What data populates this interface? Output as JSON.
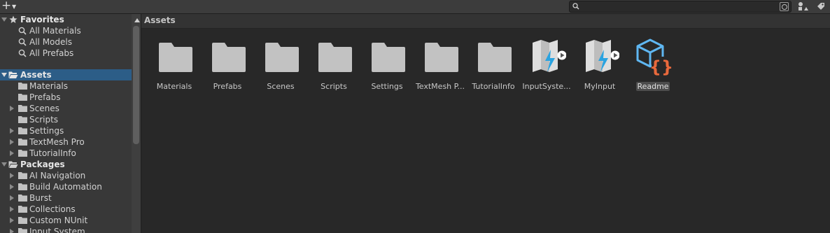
{
  "toolbar": {
    "add_icon": "plus-icon",
    "search": {
      "value": "",
      "placeholder": ""
    }
  },
  "sidebar": {
    "favorites": {
      "label": "Favorites",
      "items": [
        {
          "label": "All Materials"
        },
        {
          "label": "All Models"
        },
        {
          "label": "All Prefabs"
        }
      ]
    },
    "assets": {
      "label": "Assets",
      "items": [
        {
          "label": "Materials"
        },
        {
          "label": "Prefabs"
        },
        {
          "label": "Scenes"
        },
        {
          "label": "Scripts"
        },
        {
          "label": "Settings"
        },
        {
          "label": "TextMesh Pro"
        },
        {
          "label": "TutorialInfo"
        }
      ]
    },
    "packages": {
      "label": "Packages",
      "items": [
        {
          "label": "AI Navigation"
        },
        {
          "label": "Build Automation"
        },
        {
          "label": "Burst"
        },
        {
          "label": "Collections"
        },
        {
          "label": "Custom NUnit"
        },
        {
          "label": "Input System"
        }
      ]
    }
  },
  "main": {
    "breadcrumb": "Assets",
    "assets": [
      {
        "name": "Materials",
        "icon": "folder-icon"
      },
      {
        "name": "Prefabs",
        "icon": "folder-icon"
      },
      {
        "name": "Scenes",
        "icon": "folder-icon"
      },
      {
        "name": "Scripts",
        "icon": "folder-icon"
      },
      {
        "name": "Settings",
        "icon": "folder-icon"
      },
      {
        "name": "TextMesh P...",
        "icon": "folder-icon"
      },
      {
        "name": "TutorialInfo",
        "icon": "folder-icon"
      },
      {
        "name": "InputSyste...",
        "icon": "input-actions-icon"
      },
      {
        "name": "MyInput",
        "icon": "input-actions-icon"
      },
      {
        "name": "Readme",
        "icon": "readme-asset-icon"
      }
    ]
  },
  "colors": {
    "selection": "#2c5d87",
    "folder": "#c2c2c2",
    "input_blue": "#2aa3e0",
    "readme_blue": "#5fb7f2",
    "readme_orange": "#e8693c"
  }
}
